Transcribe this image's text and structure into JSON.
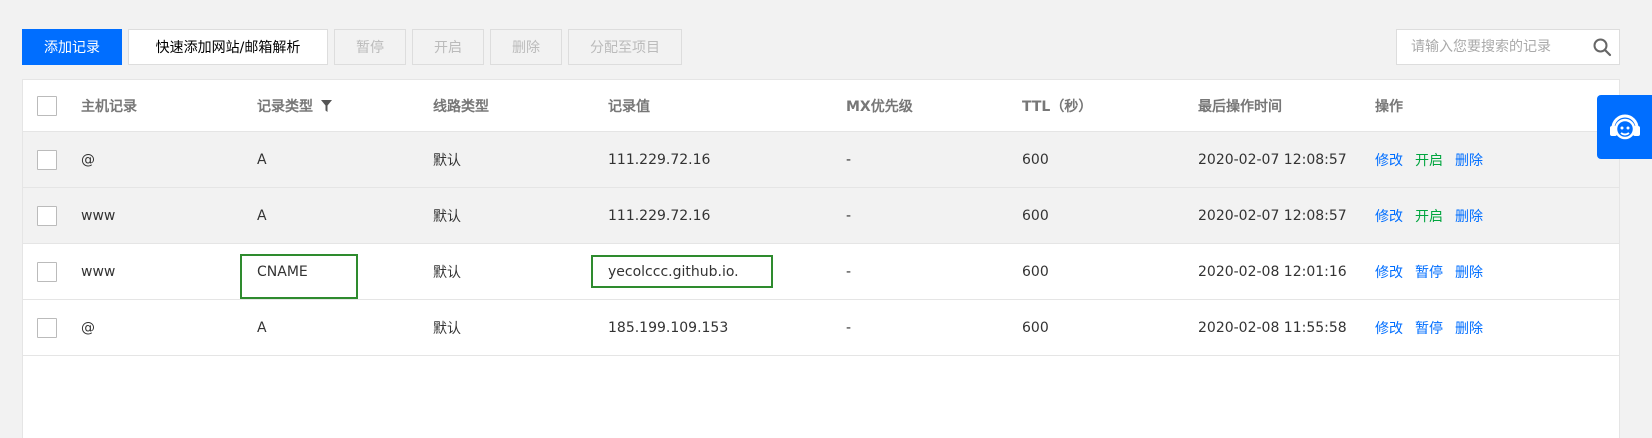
{
  "toolbar": {
    "add_label": "添加记录",
    "quick_add_label": "快速添加网站/邮箱解析",
    "pause_label": "暂停",
    "enable_label": "开启",
    "delete_label": "删除",
    "assign_label": "分配至项目"
  },
  "search": {
    "placeholder": "请输入您要搜索的记录",
    "icon": "search-icon"
  },
  "table": {
    "headers": {
      "host": "主机记录",
      "type": "记录类型",
      "line": "线路类型",
      "value": "记录值",
      "mx": "MX优先级",
      "ttl": "TTL（秒）",
      "time": "最后操作时间",
      "ops": "操作"
    },
    "rows": [
      {
        "host": "@",
        "type": "A",
        "line": "默认",
        "value": "111.229.72.16",
        "mx": "-",
        "ttl": "600",
        "time": "2020-02-07 12:08:57",
        "op1": "修改",
        "op2": "开启",
        "op3": "删除"
      },
      {
        "host": "www",
        "type": "A",
        "line": "默认",
        "value": "111.229.72.16",
        "mx": "-",
        "ttl": "600",
        "time": "2020-02-07 12:08:57",
        "op1": "修改",
        "op2": "开启",
        "op3": "删除"
      },
      {
        "host": "www",
        "type": "CNAME",
        "line": "默认",
        "value": "yecolccc.github.io.",
        "mx": "-",
        "ttl": "600",
        "time": "2020-02-08 12:01:16",
        "op1": "修改",
        "op2": "暂停",
        "op3": "删除"
      },
      {
        "host": "@",
        "type": "A",
        "line": "默认",
        "value": "185.199.109.153",
        "mx": "-",
        "ttl": "600",
        "time": "2020-02-08 11:55:58",
        "op1": "修改",
        "op2": "暂停",
        "op3": "删除"
      }
    ]
  },
  "colors": {
    "primary": "#006eff",
    "enabled_green": "#00a53e",
    "highlight_green": "#2e8b2e"
  },
  "side_widget": {
    "icon": "customer-service-icon"
  }
}
